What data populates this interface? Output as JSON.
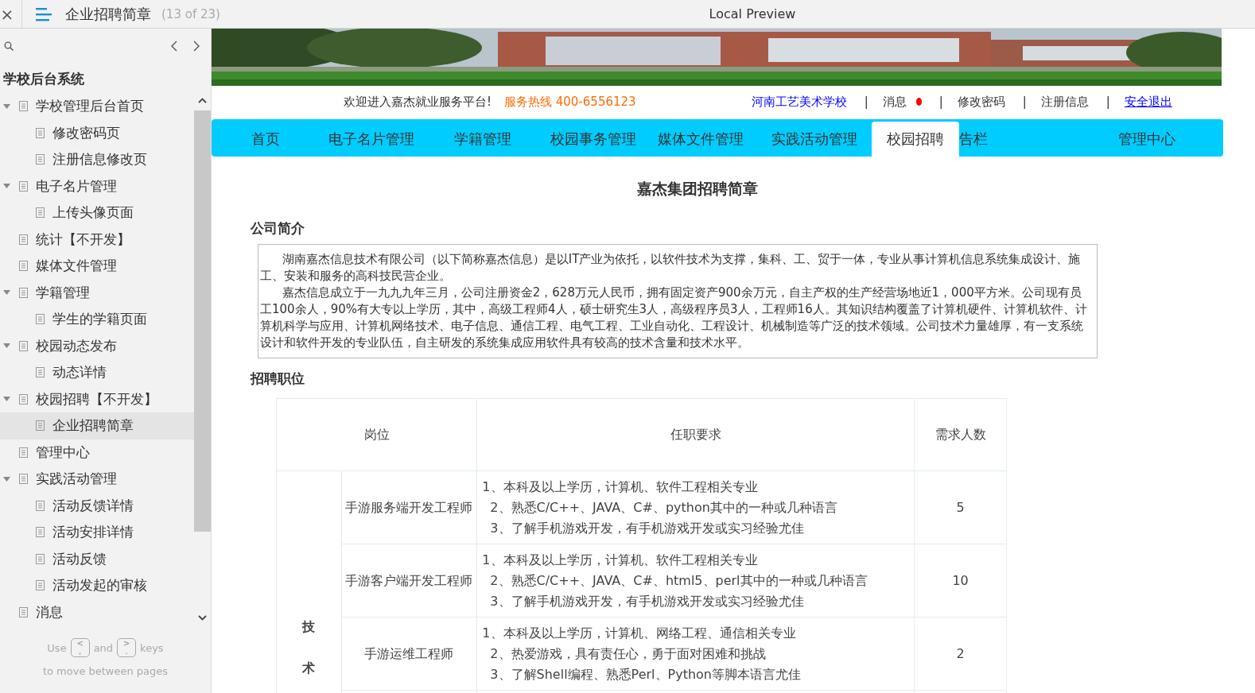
{
  "topbar": {
    "close": "×",
    "title": "企业招聘简章",
    "counter": "(13 of 23)",
    "window_title": "Local Preview"
  },
  "sidebar": {
    "root": "学校后台系统",
    "tree": [
      {
        "label": "学校管理后台首页",
        "expanded": true,
        "selected": false,
        "children": [
          {
            "label": "修改密码页",
            "selected": false
          },
          {
            "label": "注册信息修改页",
            "selected": false
          }
        ]
      },
      {
        "label": "电子名片管理",
        "expanded": true,
        "selected": false,
        "children": [
          {
            "label": "上传头像页面",
            "selected": false
          }
        ]
      },
      {
        "label": "统计【不开发】",
        "selected": false
      },
      {
        "label": "媒体文件管理",
        "selected": false
      },
      {
        "label": "学籍管理",
        "expanded": true,
        "selected": false,
        "children": [
          {
            "label": "学生的学籍页面",
            "selected": false
          }
        ]
      },
      {
        "label": "校园动态发布",
        "expanded": true,
        "selected": false,
        "children": [
          {
            "label": "动态详情",
            "selected": false
          }
        ]
      },
      {
        "label": "校园招聘【不开发】",
        "expanded": true,
        "selected": false,
        "children": [
          {
            "label": "企业招聘简章",
            "selected": true
          }
        ]
      },
      {
        "label": "管理中心",
        "selected": false
      },
      {
        "label": "实践活动管理",
        "expanded": true,
        "selected": false,
        "children": [
          {
            "label": "活动反馈详情",
            "selected": false
          },
          {
            "label": "活动安排详情",
            "selected": false
          },
          {
            "label": "活动反馈",
            "selected": false
          },
          {
            "label": "活动发起的审核",
            "selected": false
          }
        ]
      },
      {
        "label": "消息",
        "selected": false
      }
    ],
    "footer": {
      "use": "Use",
      "key_prev": {
        "top": "<",
        "bottom": ","
      },
      "and": "and",
      "key_next": {
        "top": ">",
        "bottom": "."
      },
      "keys": "keys",
      "line2": "to move between pages"
    }
  },
  "page": {
    "info": {
      "welcome": "欢迎进入嘉杰就业服务平台!",
      "hotline": "服务热线  400-6556123",
      "links": [
        {
          "kind": "school",
          "text": "河南工艺美术学校"
        },
        {
          "kind": "separator",
          "text": "|"
        },
        {
          "kind": "text",
          "text": "消息",
          "unread": true
        },
        {
          "kind": "separator",
          "text": "|"
        },
        {
          "kind": "text",
          "text": "修改密码"
        },
        {
          "kind": "separator",
          "text": "|"
        },
        {
          "kind": "text",
          "text": "注册信息"
        },
        {
          "kind": "separator",
          "text": "|"
        },
        {
          "kind": "link",
          "text": "安全退出"
        }
      ]
    },
    "nav": [
      {
        "label": "首页",
        "selected": false
      },
      {
        "label": "电子名片管理",
        "selected": false
      },
      {
        "label": "学籍管理",
        "selected": false
      },
      {
        "label": "校园事务管理",
        "selected": false
      },
      {
        "label": "媒体文件管理",
        "selected": false
      },
      {
        "label": "实践活动管理",
        "selected": false
      },
      {
        "label": "校园招聘",
        "selected": true
      },
      {
        "label": "告栏",
        "selected": false
      },
      {
        "label": "管理中心",
        "selected": false
      }
    ],
    "title": "嘉杰集团招聘简章",
    "intro_heading": "公司简介",
    "intro": [
      "湖南嘉杰信息技术有限公司（以下简称嘉杰信息）是以IT产业为依托，以软件技术为支撑，集科、工、贸于一体，专业从事计算机信息系统集成设计、施工、安装和服务的高科技民营企业。",
      "嘉杰信息成立于一九九九年三月，公司注册资金2，628万元人民币，拥有固定资产900余万元，自主产权的生产经营场地近1，000平方米。公司现有员工100余人，90%有大专以上学历，其中，高级工程师4人，硕士研究生3人，高级程序员3人，工程师16人。其知识结构覆盖了计算机硬件、计算机软件、计算机科学与应用、计算机网络技术、电子信息、通信工程、电气工程、工业自动化、工程设计、机械制造等广泛的技术领域。公司技术力量雄厚，有一支系统设计和软件开发的专业队伍，自主研发的系统集成应用软件具有较高的技术含量和技术水平。"
    ],
    "jobs_heading": "招聘职位",
    "table": {
      "columns": [
        "岗位",
        "任职要求",
        "需求人数"
      ],
      "category": "技术",
      "rows": [
        {
          "position": "手游服务端开发工程师",
          "requirements": [
            "1、本科及以上学历，计算机、软件工程相关专业",
            "2、熟悉C/C++、JAVA、C#、python其中的一种或几种语言",
            "3、了解手机游戏开发，有手机游戏开发或实习经验尤佳"
          ],
          "count": "5"
        },
        {
          "position": "手游客户端开发工程师",
          "requirements": [
            "1、本科及以上学历，计算机、软件工程相关专业",
            "2、熟悉C/C++、JAVA、C#、html5、perl其中的一种或几种语言",
            "3、了解手机游戏开发，有手机游戏开发或实习经验尤佳"
          ],
          "count": "10"
        },
        {
          "position": "手游运维工程师",
          "requirements": [
            "1、本科及以上学历，计算机、网络工程、通信相关专业",
            "2、热爱游戏，具有责任心，勇于面对困难和挑战",
            "3、了解Shell编程、熟悉Perl、Python等脚本语言尤佳"
          ],
          "count": "2"
        }
      ]
    }
  }
}
